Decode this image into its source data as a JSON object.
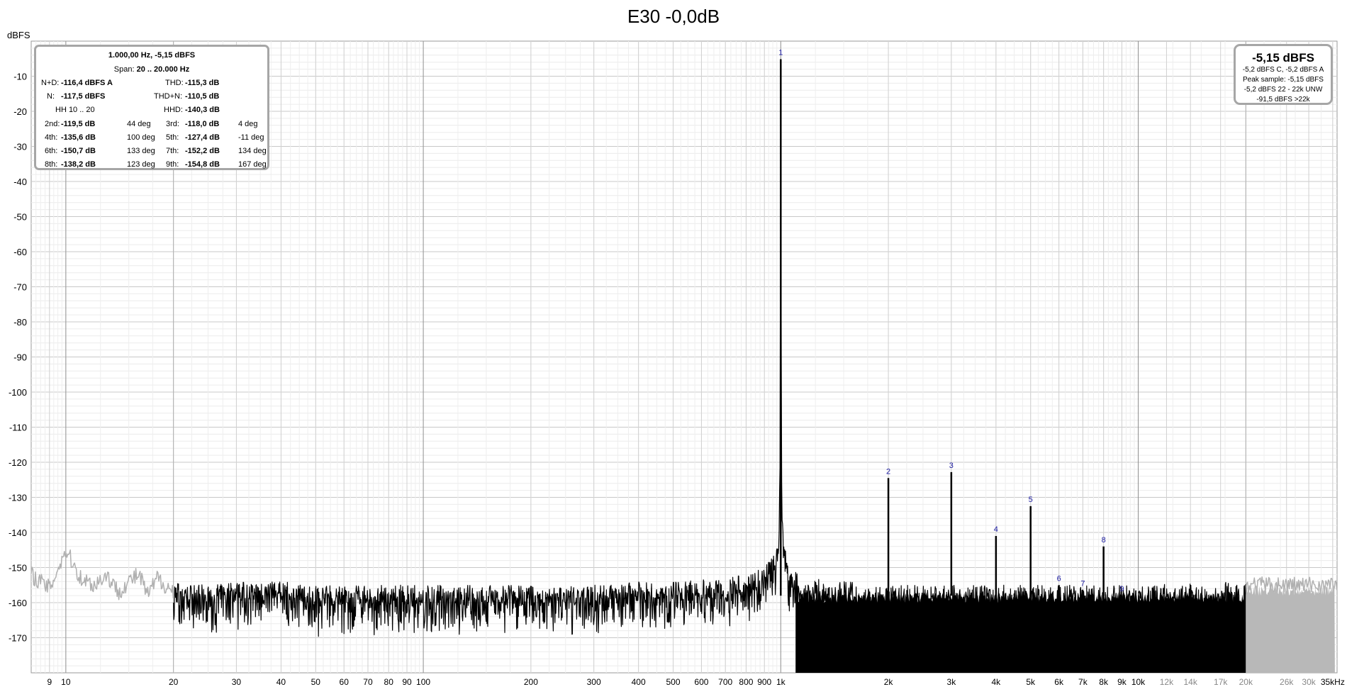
{
  "chart_data": {
    "type": "line",
    "title": "E30 -0,0dB",
    "ylabel": "dBFS",
    "xlabel": "",
    "x_scale": "log",
    "xlim": [
      8,
      36000
    ],
    "ylim": [
      -180,
      0
    ],
    "y_ticks": [
      -10,
      -20,
      -30,
      -40,
      -50,
      -60,
      -70,
      -80,
      -90,
      -100,
      -110,
      -120,
      -130,
      -140,
      -150,
      -160,
      -170
    ],
    "x_ticks": [
      {
        "value": 9,
        "label": "9"
      },
      {
        "value": 10,
        "label": "10"
      },
      {
        "value": 20,
        "label": "20"
      },
      {
        "value": 30,
        "label": "30"
      },
      {
        "value": 40,
        "label": "40"
      },
      {
        "value": 50,
        "label": "50"
      },
      {
        "value": 60,
        "label": "60"
      },
      {
        "value": 70,
        "label": "70"
      },
      {
        "value": 80,
        "label": "80"
      },
      {
        "value": 90,
        "label": "90"
      },
      {
        "value": 100,
        "label": "100"
      },
      {
        "value": 200,
        "label": "200"
      },
      {
        "value": 300,
        "label": "300"
      },
      {
        "value": 400,
        "label": "400"
      },
      {
        "value": 500,
        "label": "500"
      },
      {
        "value": 600,
        "label": "600"
      },
      {
        "value": 700,
        "label": "700"
      },
      {
        "value": 800,
        "label": "800"
      },
      {
        "value": 900,
        "label": "900"
      },
      {
        "value": 1000,
        "label": "1k"
      },
      {
        "value": 2000,
        "label": "2k"
      },
      {
        "value": 3000,
        "label": "3k"
      },
      {
        "value": 4000,
        "label": "4k"
      },
      {
        "value": 5000,
        "label": "5k"
      },
      {
        "value": 6000,
        "label": "6k"
      },
      {
        "value": 7000,
        "label": "7k"
      },
      {
        "value": 8000,
        "label": "8k"
      },
      {
        "value": 9000,
        "label": "9k"
      },
      {
        "value": 10000,
        "label": "10k"
      },
      {
        "value": 12000,
        "label": "12k"
      },
      {
        "value": 14000,
        "label": "14k"
      },
      {
        "value": 17000,
        "label": "17k"
      },
      {
        "value": 20000,
        "label": "20k"
      },
      {
        "value": 26000,
        "label": "26k"
      },
      {
        "value": 30000,
        "label": "30k"
      },
      {
        "value": 35000,
        "label": "35kHz"
      }
    ],
    "grid": true,
    "series": [
      {
        "color": "#000000",
        "band": [
          20,
          20000
        ],
        "x": [
          20,
          25,
          30,
          40,
          50,
          70,
          100,
          150,
          200,
          300,
          400,
          500,
          600,
          700,
          800,
          900,
          950,
          980,
          990,
          995,
          1000,
          1005,
          1010,
          1020,
          1050,
          1100,
          1200,
          1500,
          2000,
          3000,
          5000,
          10000,
          20000
        ],
        "y": [
          -157,
          -158,
          -157,
          -157,
          -158,
          -158,
          -158,
          -158,
          -158,
          -158,
          -157,
          -157,
          -156,
          -156,
          -155,
          -153,
          -150,
          -145,
          -138,
          -125,
          -5,
          -125,
          -138,
          -145,
          -151,
          -154,
          -156,
          -157,
          -158,
          -158,
          -158,
          -158,
          -157
        ]
      },
      {
        "color": "#b0b0b0",
        "band": [
          8,
          20
        ],
        "x": [
          8,
          9,
          10,
          11,
          12,
          13,
          14,
          15,
          16,
          17,
          18,
          19,
          20
        ],
        "y": [
          -152,
          -156,
          -145,
          -153,
          -155,
          -152,
          -157,
          -154,
          -152,
          -158,
          -153,
          -155,
          -157
        ]
      },
      {
        "color": "#b0b0b0",
        "band": [
          20000,
          36000
        ],
        "x": [
          20000,
          25000,
          30000,
          36000
        ],
        "y": [
          -155,
          -155,
          -155,
          -155
        ]
      }
    ],
    "harmonics": [
      {
        "label": "1",
        "x": 1000,
        "y": -5.15
      },
      {
        "label": "2",
        "x": 2000,
        "y": -124.5
      },
      {
        "label": "3",
        "x": 3000,
        "y": -122.8
      },
      {
        "label": "4",
        "x": 4000,
        "y": -141.0
      },
      {
        "label": "5",
        "x": 5000,
        "y": -132.5
      },
      {
        "label": "6",
        "x": 6000,
        "y": -155.0
      },
      {
        "label": "7",
        "x": 7000,
        "y": -156.5
      },
      {
        "label": "8",
        "x": 8000,
        "y": -144.0
      },
      {
        "label": "9",
        "x": 9000,
        "y": -158.0
      }
    ],
    "info_box": {
      "line1": "1.000,00 Hz, -5,15 dBFS",
      "span_label": "Span:",
      "span_value": "20 .. 20.000 Hz",
      "nd_label": "N+D:",
      "nd_value": "-116,4 dBFS A",
      "thd_label": "THD:",
      "thd_value": "-115,3 dB",
      "n_label": "N:",
      "n_value": "-117,5 dBFS",
      "thdn_label": "THD+N:",
      "thdn_value": "-110,5 dB",
      "hh_label": "HH 10 .. 20",
      "hhd_label": "HHD:",
      "hhd_value": "-140,3 dB",
      "rows": [
        {
          "l1": "2nd:",
          "v1": "-119,5 dB",
          "p1": "44 deg",
          "l2": "3rd:",
          "v2": "-118,0 dB",
          "p2": "4 deg"
        },
        {
          "l1": "4th:",
          "v1": "-135,6 dB",
          "p1": "100 deg",
          "l2": "5th:",
          "v2": "-127,4 dB",
          "p2": "-11 deg"
        },
        {
          "l1": "6th:",
          "v1": "-150,7 dB",
          "p1": "133 deg",
          "l2": "7th:",
          "v2": "-152,2 dB",
          "p2": "134 deg"
        },
        {
          "l1": "8th:",
          "v1": "-138,2 dB",
          "p1": "123 deg",
          "l2": "9th:",
          "v2": "-154,8 dB",
          "p2": "167 deg"
        }
      ]
    },
    "level_box": {
      "main": "-5,15 dBFS",
      "lines": [
        "-5,2 dBFS C, -5,2 dBFS A",
        "Peak sample: -5,15 dBFS",
        "-5,2 dBFS 22 - 22k UNW",
        "-91,5 dBFS >22k"
      ]
    }
  }
}
